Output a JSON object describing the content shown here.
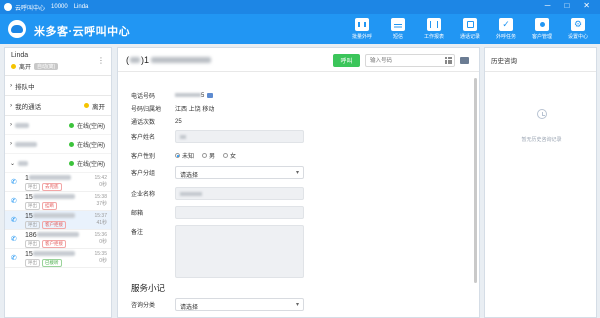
{
  "window": {
    "app_name": "云呼叫中心",
    "account": "10000",
    "user": "Linda",
    "minimize": "─",
    "maximize": "□",
    "close": "✕"
  },
  "header": {
    "title": "米多客·云呼叫中心",
    "toolbar": [
      {
        "label": "批量外呼",
        "icon": "bulk-dial-icon"
      },
      {
        "label": "短信",
        "icon": "sms-icon"
      },
      {
        "label": "工作报表",
        "icon": "report-icon"
      },
      {
        "label": "通话记录",
        "icon": "call-log-icon"
      },
      {
        "label": "外呼任务",
        "icon": "task-icon"
      },
      {
        "label": "客户管理",
        "icon": "customer-icon"
      },
      {
        "label": "设置中心",
        "icon": "settings-icon"
      }
    ]
  },
  "agent": {
    "name": "Linda",
    "status": "离开",
    "badge": "自动(离)",
    "more": "⋮"
  },
  "sections": {
    "queue": "排队中",
    "my_calls": "我的通话",
    "my_calls_status": "离开"
  },
  "members": [
    {
      "name_prefix": "",
      "status": "在线(空闲)"
    },
    {
      "name_prefix": "",
      "status": "在线(空闲)"
    },
    {
      "name_prefix": "",
      "status": "在线(空闲)"
    }
  ],
  "calls": [
    {
      "prefix": "1",
      "tag1": "呼出",
      "tag2": "去兜底",
      "tag2_style": "red",
      "time": "15:42",
      "duration": "0秒"
    },
    {
      "prefix": "15",
      "tag1": "呼出",
      "tag2": "挂断",
      "tag2_style": "red",
      "time": "15:38",
      "duration": "37秒"
    },
    {
      "prefix": "15",
      "tag1": "呼出",
      "tag2": "客户拒接",
      "tag2_style": "red",
      "time": "15:37",
      "duration": "41秒"
    },
    {
      "prefix": "186",
      "tag1": "呼出",
      "tag2": "客户拒接",
      "tag2_style": "red",
      "time": "15:36",
      "duration": "0秒"
    },
    {
      "prefix": "15",
      "tag1": "呼出",
      "tag2": "已接听",
      "tag2_style": "green",
      "time": "15:35",
      "duration": "0秒"
    }
  ],
  "detail": {
    "phone_prefix": "(",
    "phone_visible": ")1",
    "phone_tail": "5",
    "call_button": "呼叫",
    "number_placeholder": "输入号码",
    "fields": {
      "phone_label": "电话号码",
      "location_label": "号码归属地",
      "location_value": "江西 上饶 移动",
      "call_count_label": "通话次数",
      "call_count_value": "25",
      "customer_name_label": "客户姓名",
      "gender_label": "客户性别",
      "gender_options": [
        "未知",
        "男",
        "女"
      ],
      "group_label": "客户分组",
      "group_value": "请选择",
      "company_label": "企业名称",
      "email_label": "邮箱",
      "remark_label": "备注"
    },
    "summary_title": "服务小记",
    "inquiry_label": "咨询分类",
    "inquiry_value": "请选择"
  },
  "history": {
    "title": "历史咨询",
    "empty_text": "暂无历史咨询记录"
  }
}
